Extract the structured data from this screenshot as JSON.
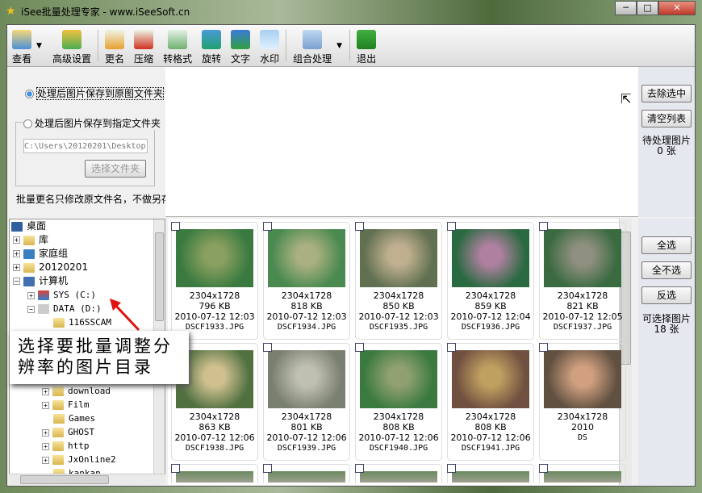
{
  "title": "iSee批量处理专家 - www.iSeeSoft.cn",
  "toolbar": [
    {
      "label": "查看",
      "icon": "view-icon"
    },
    {
      "label": "高级设置",
      "icon": "settings-icon"
    },
    {
      "label": "更名",
      "icon": "rename-icon"
    },
    {
      "label": "压缩",
      "icon": "compress-icon"
    },
    {
      "label": "转格式",
      "icon": "convert-icon"
    },
    {
      "label": "旋转",
      "icon": "rotate-icon"
    },
    {
      "label": "文字",
      "icon": "text-icon"
    },
    {
      "label": "水印",
      "icon": "watermark-icon"
    },
    {
      "label": "组合处理",
      "icon": "combo-icon"
    },
    {
      "label": "退出",
      "icon": "exit-icon"
    }
  ],
  "options": {
    "save_original": "处理后图片保存到原图文件夹",
    "save_specified": "处理后图片保存到指定文件夹",
    "path": "C:\\Users\\20120201\\Desktop",
    "choose_folder": "选择文件夹",
    "note": "批量更名只修改原文件名，不做另存"
  },
  "pending": {
    "remove": "去除选中",
    "clear": "清空列表",
    "label": "待处理图片",
    "count": "0 张"
  },
  "select": {
    "all": "全选",
    "none": "全不选",
    "invert": "反选",
    "label": "可选择图片",
    "count": "18 张"
  },
  "tree": [
    "桌面",
    "库",
    "家庭组",
    "20120201",
    "计算机",
    "SYS (C:)",
    "DATA (D:)",
    "116SSCAM",
    "download",
    "Film",
    "Games",
    "GHOST",
    "http",
    "JxOnline2",
    "kankan"
  ],
  "callout": "选择要批量调整分辨率的图片目录",
  "images": [
    {
      "dim": "2304x1728",
      "size": "796 KB",
      "date": "2010-07-12 12:03",
      "name": "DSCF1933.JPG"
    },
    {
      "dim": "2304x1728",
      "size": "818 KB",
      "date": "2010-07-12 12:03",
      "name": "DSCF1934.JPG"
    },
    {
      "dim": "2304x1728",
      "size": "850 KB",
      "date": "2010-07-12 12:03",
      "name": "DSCF1935.JPG"
    },
    {
      "dim": "2304x1728",
      "size": "859 KB",
      "date": "2010-07-12 12:04",
      "name": "DSCF1936.JPG"
    },
    {
      "dim": "2304x1728",
      "size": "821 KB",
      "date": "2010-07-12 12:05",
      "name": "DSCF1937.JPG"
    },
    {
      "dim": "2304x1728",
      "size": "863 KB",
      "date": "2010-07-12 12:06",
      "name": "DSCF1938.JPG"
    },
    {
      "dim": "2304x1728",
      "size": "801 KB",
      "date": "2010-07-12 12:06",
      "name": "DSCF1939.JPG"
    },
    {
      "dim": "2304x1728",
      "size": "808 KB",
      "date": "2010-07-12 12:06",
      "name": "DSCF1940.JPG"
    },
    {
      "dim": "2304x1728",
      "size": "808 KB",
      "date": "2010-07-12 12:06",
      "name": "DSCF1941.JPG"
    },
    {
      "dim": "2304x1728",
      "size": "",
      "date": "2010",
      "name": "DS"
    }
  ]
}
